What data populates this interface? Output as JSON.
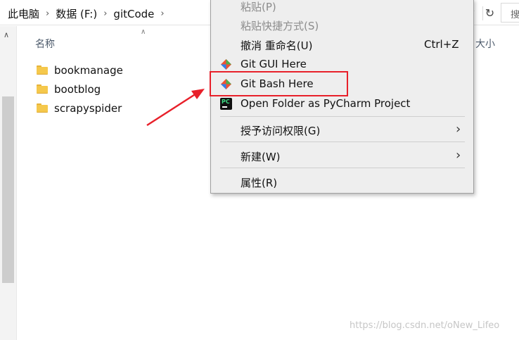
{
  "address_bar": {
    "crumbs": [
      "此电脑",
      "数据 (F:)",
      "gitCode"
    ],
    "search_fragment": "搜"
  },
  "columns": {
    "name": "名称",
    "size": "大小"
  },
  "files": [
    {
      "name": "bookmanage"
    },
    {
      "name": "bootblog"
    },
    {
      "name": "scrapyspider"
    }
  ],
  "context_menu": {
    "items": [
      {
        "label": "粘贴(P)",
        "disabled": true
      },
      {
        "label": "粘贴快捷方式(S)",
        "disabled": true
      },
      {
        "label": "撤消 重命名(U)",
        "shortcut": "Ctrl+Z"
      },
      {
        "label": "Git GUI Here",
        "icon": "git-icon"
      },
      {
        "label": "Git Bash Here",
        "icon": "git-icon"
      },
      {
        "label": "Open Folder as PyCharm Project",
        "icon": "pycharm-icon"
      },
      {
        "label": "授予访问权限(G)",
        "submenu": true
      },
      {
        "label": "新建(W)",
        "submenu": true
      },
      {
        "label": "属性(R)"
      }
    ]
  },
  "annotation": {
    "highlight_color": "#e8202a"
  },
  "watermark": "https://blog.csdn.net/oNew_Lifeo"
}
